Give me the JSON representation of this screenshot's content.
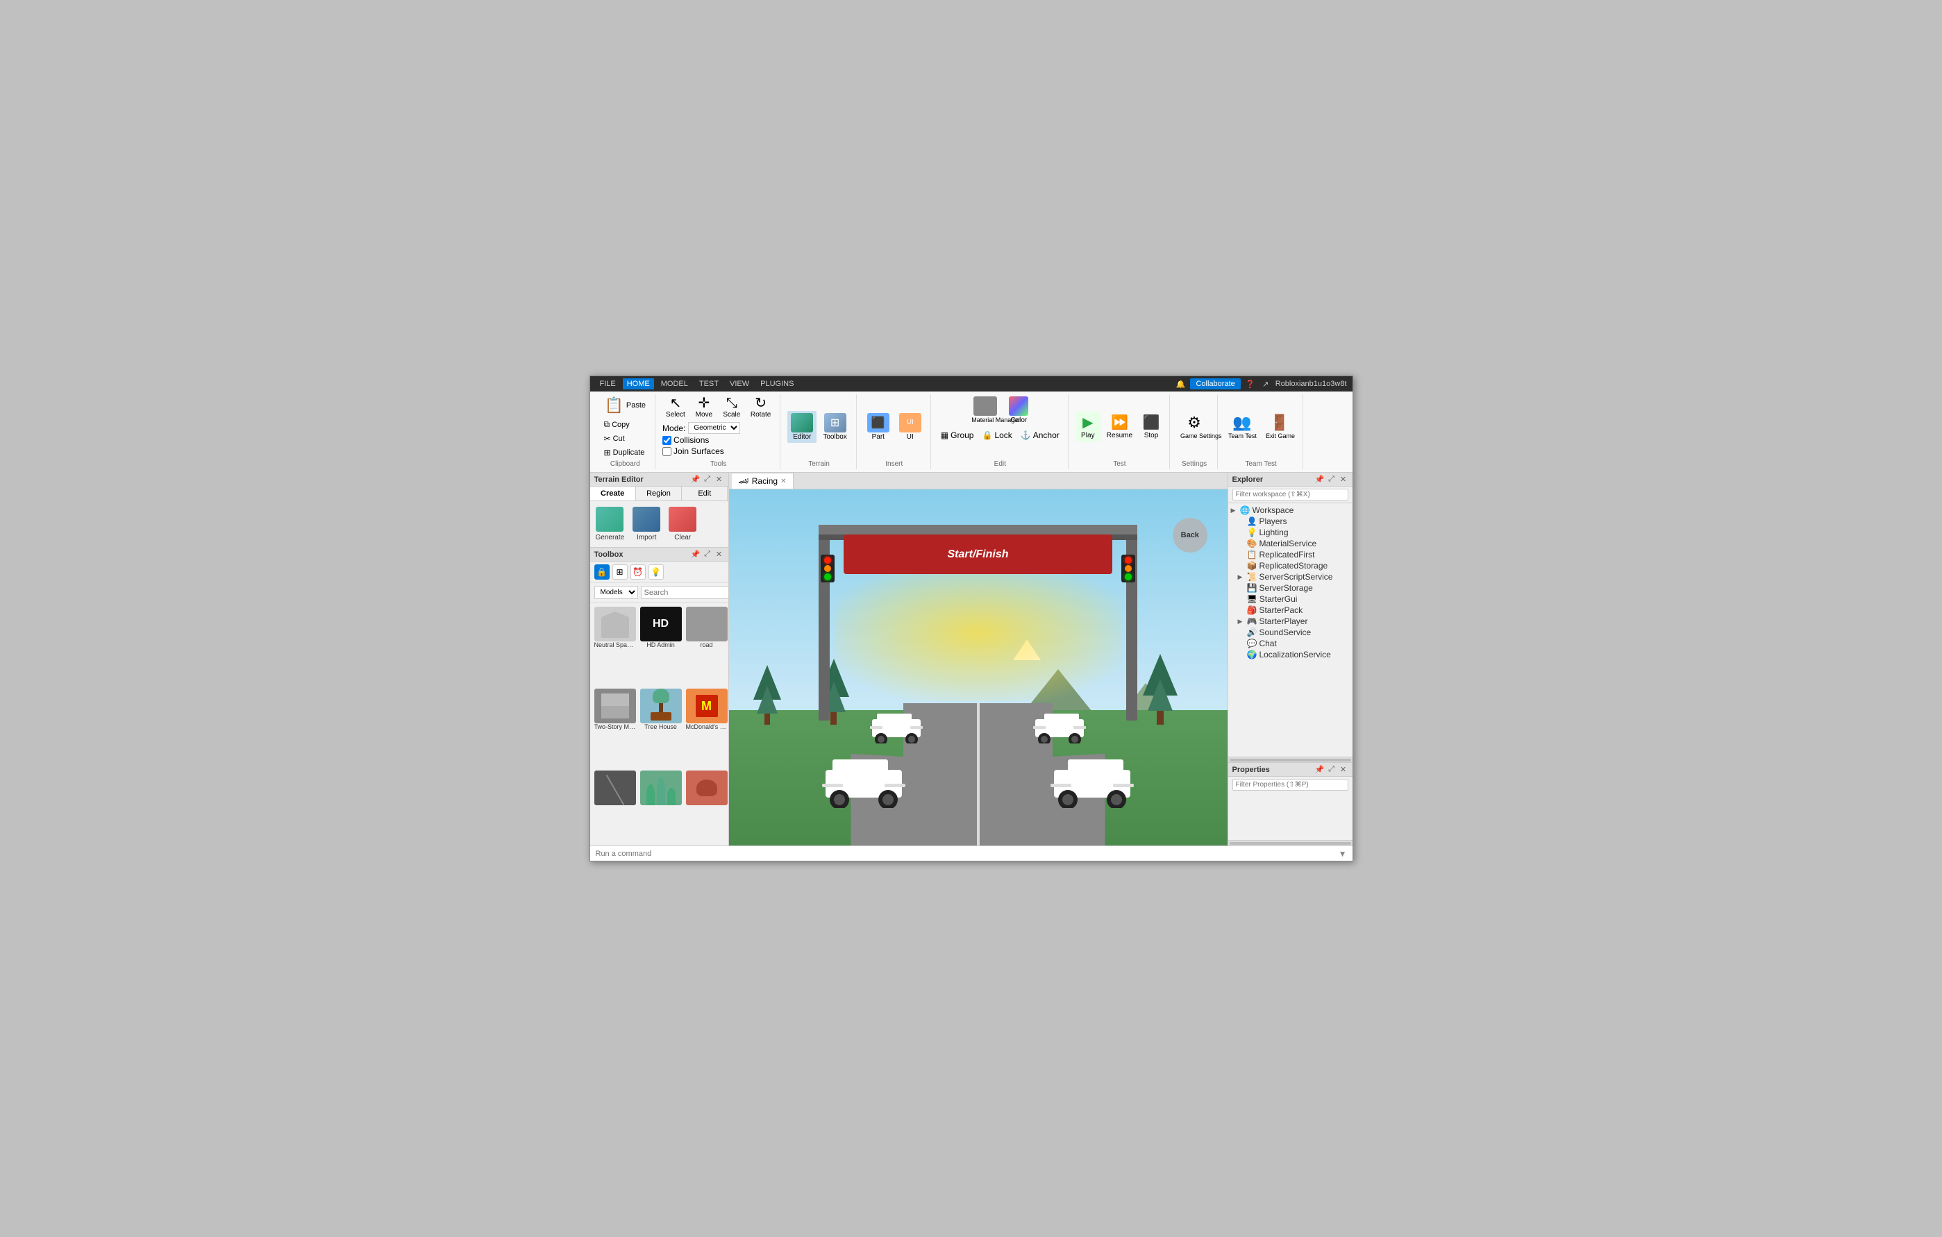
{
  "titleBar": {
    "menuItems": [
      "FILE",
      "HOME",
      "MODEL",
      "TEST",
      "VIEW",
      "PLUGINS"
    ],
    "activeMenu": "HOME",
    "collaborateLabel": "Collaborate",
    "userName": "Robloxianb1u1o3w8t",
    "icons": [
      "bell",
      "help",
      "share"
    ]
  },
  "ribbon": {
    "clipboard": {
      "label": "Clipboard",
      "paste": "Paste",
      "copy": "Copy",
      "cut": "Cut",
      "duplicate": "Duplicate"
    },
    "tools": {
      "label": "Tools",
      "select": "Select",
      "move": "Move",
      "scale": "Scale",
      "rotate": "Rotate",
      "modeLabel": "Mode:",
      "modeValue": "Geometric",
      "collisions": "Collisions",
      "joinSurfaces": "Join Surfaces"
    },
    "terrain": {
      "label": "Terrain",
      "editor": "Editor",
      "toolbox": "Toolbox"
    },
    "insert": {
      "label": "Insert",
      "part": "Part",
      "ui": "UI"
    },
    "edit": {
      "label": "Edit",
      "materialManager": "Material Manager",
      "color": "Color",
      "group": "Group",
      "lock": "Lock",
      "anchor": "Anchor"
    },
    "test": {
      "label": "Test",
      "play": "Play",
      "resume": "Resume",
      "stop": "Stop",
      "gameSettings": "Game Settings"
    },
    "settings": {
      "label": "Settings",
      "gameSettings": "Game\nSettings"
    },
    "teamTest": {
      "label": "Team Test",
      "teamTest": "Team\nTest",
      "exitGame": "Exit\nGame"
    }
  },
  "terrainEditor": {
    "title": "Terrain Editor",
    "tabs": [
      "Create",
      "Region",
      "Edit"
    ],
    "activeTab": "Create",
    "items": [
      "Generate",
      "Import",
      "Clear"
    ]
  },
  "toolbox": {
    "title": "Toolbox",
    "filters": [
      "lock",
      "grid",
      "clock",
      "bulb"
    ],
    "modelsLabel": "Models",
    "searchPlaceholder": "Search",
    "items": [
      {
        "label": "Neutral Spawn...",
        "color": "#ddd"
      },
      {
        "label": "HD Admin",
        "color": "#111",
        "textColor": "white",
        "text": "HD"
      },
      {
        "label": "road",
        "color": "#999"
      },
      {
        "label": "Two-Story Modern...",
        "color": "#888"
      },
      {
        "label": "Tree House",
        "color": "#5a8"
      },
      {
        "label": "McDonald's Restaurant",
        "color": "#e84"
      },
      {
        "label": "",
        "color": "#555"
      },
      {
        "label": "",
        "color": "#6a8"
      },
      {
        "label": "",
        "color": "#c65"
      }
    ]
  },
  "viewport": {
    "tabs": [
      {
        "label": "Racing",
        "hasClose": true,
        "icon": "🏎"
      }
    ],
    "scene": {
      "backButton": "Back",
      "startFinishText": "Start/Finish"
    }
  },
  "explorer": {
    "title": "Explorer",
    "filterPlaceholder": "Filter workspace (⇧⌘X)",
    "items": [
      {
        "label": "Workspace",
        "hasArrow": true,
        "indent": 0,
        "icon": "🌐"
      },
      {
        "label": "Players",
        "hasArrow": false,
        "indent": 1,
        "icon": "👤"
      },
      {
        "label": "Lighting",
        "hasArrow": false,
        "indent": 1,
        "icon": "💡"
      },
      {
        "label": "MaterialService",
        "hasArrow": false,
        "indent": 1,
        "icon": "🎨"
      },
      {
        "label": "ReplicatedFirst",
        "hasArrow": false,
        "indent": 1,
        "icon": "📋"
      },
      {
        "label": "ReplicatedStorage",
        "hasArrow": false,
        "indent": 1,
        "icon": "📦"
      },
      {
        "label": "ServerScriptService",
        "hasArrow": true,
        "indent": 1,
        "icon": "📜"
      },
      {
        "label": "ServerStorage",
        "hasArrow": false,
        "indent": 1,
        "icon": "💾"
      },
      {
        "label": "StarterGui",
        "hasArrow": false,
        "indent": 1,
        "icon": "🖥"
      },
      {
        "label": "StarterPack",
        "hasArrow": false,
        "indent": 1,
        "icon": "🎒"
      },
      {
        "label": "StarterPlayer",
        "hasArrow": true,
        "indent": 1,
        "icon": "🎮"
      },
      {
        "label": "SoundService",
        "hasArrow": false,
        "indent": 1,
        "icon": "🔊"
      },
      {
        "label": "Chat",
        "hasArrow": false,
        "indent": 1,
        "icon": "💬"
      },
      {
        "label": "LocalizationService",
        "hasArrow": false,
        "indent": 1,
        "icon": "🌍"
      }
    ]
  },
  "properties": {
    "title": "Properties",
    "filterPlaceholder": "Filter Properties (⇧⌘P)"
  },
  "statusBar": {
    "placeholder": "Run a command"
  }
}
